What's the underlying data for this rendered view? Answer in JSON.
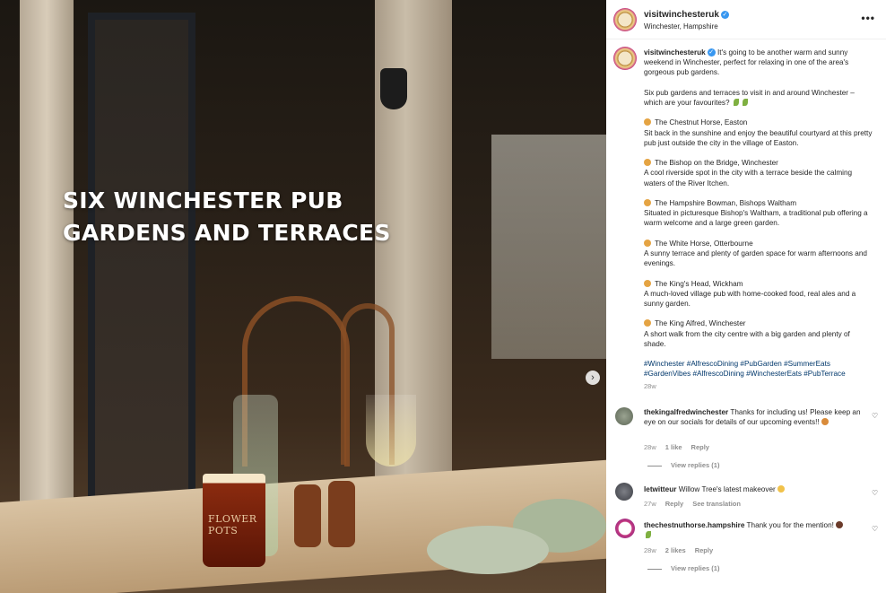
{
  "post_image": {
    "headline_line1": "SIX WINCHESTER PUB",
    "headline_line2": "GARDENS AND TERRACES",
    "beer_glass_text": "FLOWER POTS",
    "next_icon": "chevron-right-icon"
  },
  "header": {
    "username": "visitwinchesteruk",
    "location": "Winchester, Hampshire",
    "more_icon": "more-horizontal-icon"
  },
  "caption": {
    "username": "visitwinchesteruk",
    "intro": "It's going to be another warm and sunny weekend in Winchester, perfect for relaxing in one of the area's gorgeous pub gardens.",
    "question": "Six pub gardens and terraces to visit in and around Winchester – which are your favourites?",
    "pubs": [
      {
        "name": "The Chestnut Horse, Easton",
        "desc": "Sit back in the sunshine and enjoy the beautiful courtyard at this pretty pub just outside the city in the village of Easton."
      },
      {
        "name": "The Bishop on the Bridge, Winchester",
        "desc": "A cool riverside spot in the city with a terrace beside the calming waters of the River Itchen."
      },
      {
        "name": "The Hampshire Bowman, Bishops Waltham",
        "desc": "Situated in picturesque Bishop's Waltham, a traditional pub offering a warm welcome and a large green garden."
      },
      {
        "name": "The White Horse, Otterbourne",
        "desc": "A sunny terrace and plenty of garden space for warm afternoons and evenings."
      },
      {
        "name": "The King's Head, Wickham",
        "desc": "A much-loved village pub with home-cooked food, real ales and a sunny garden."
      },
      {
        "name": "The King Alfred, Winchester",
        "desc": "A short walk from the city centre with a big garden and plenty of shade."
      }
    ],
    "hashtags": "#Winchester #AlfrescoDining #PubGarden #SummerEats #GardenVibes #AlfrescoDining #WinchesterEats #PubTerrace",
    "time": "28w"
  },
  "comments": [
    {
      "username": "thekingalfredwinchester",
      "text": "Thanks for including us! Please keep an eye on our socials for details of our upcoming events!!",
      "time": "28w",
      "likes": "1 like",
      "reply": "Reply",
      "view_replies": "View replies (1)"
    },
    {
      "username": "letwitteur",
      "text": "Willow Tree's latest makeover",
      "time": "27w",
      "reply": "Reply",
      "translation": "See translation"
    },
    {
      "username": "thechestnuthorse.hampshire",
      "text": "Thank you for the mention!",
      "time": "28w",
      "likes": "2 likes",
      "reply": "Reply",
      "view_replies": "View replies (1)"
    }
  ],
  "colors": {
    "link": "#00376b",
    "verified": "#3897f0",
    "muted": "#8e8e8e"
  }
}
